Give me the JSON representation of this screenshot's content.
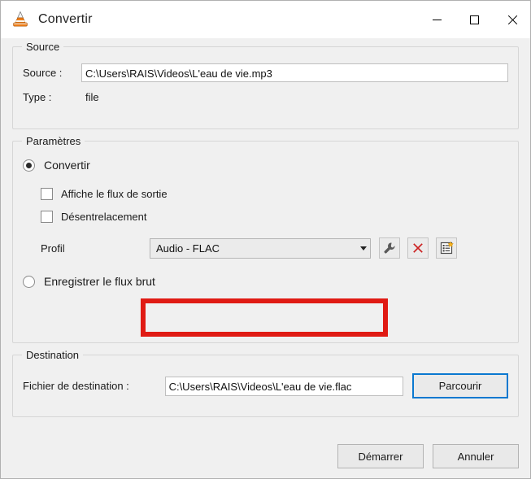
{
  "window": {
    "title": "Convertir",
    "icon": "vlc-cone-icon",
    "controls": {
      "minimize": "minimize-icon",
      "maximize": "maximize-icon",
      "close": "close-icon"
    }
  },
  "source": {
    "group_title": "Source",
    "source_label": "Source :",
    "source_value": "C:\\Users\\RAIS\\Videos\\L'eau de vie.mp3",
    "type_label": "Type :",
    "type_value": "file"
  },
  "settings": {
    "group_title": "Paramètres",
    "convert_radio": {
      "label": "Convertir",
      "selected": true
    },
    "checkboxes": [
      {
        "label": "Affiche le flux de sortie",
        "checked": false
      },
      {
        "label": "Désentrelacement",
        "checked": false
      }
    ],
    "profile": {
      "label": "Profil",
      "selected": "Audio - FLAC",
      "highlight_color": "#e01b14",
      "buttons": [
        {
          "name": "edit-profile-button",
          "icon": "wrench-icon"
        },
        {
          "name": "delete-profile-button",
          "icon": "red-x-icon"
        },
        {
          "name": "new-profile-button",
          "icon": "new-profile-icon"
        }
      ]
    },
    "raw_radio": {
      "label": "Enregistrer le flux brut",
      "selected": false
    }
  },
  "destination": {
    "group_title": "Destination",
    "file_label": "Fichier de destination :",
    "file_value": "C:\\Users\\RAIS\\Videos\\L'eau de vie.flac",
    "browse_label": "Parcourir"
  },
  "footer": {
    "start_label": "Démarrer",
    "cancel_label": "Annuler"
  }
}
